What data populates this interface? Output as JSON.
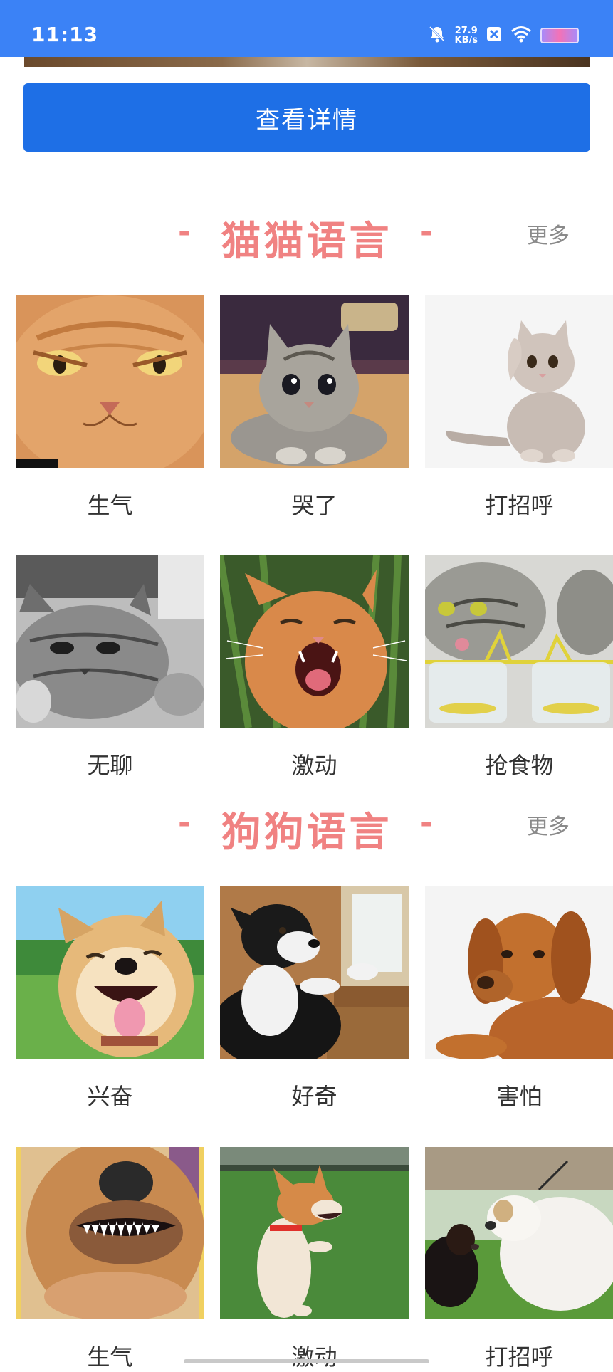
{
  "status_bar": {
    "time": "11:13",
    "net_speed_value": "27.9",
    "net_speed_unit": "KB/s"
  },
  "detail_button_label": "查看详情",
  "cat_section": {
    "title": "猫猫语言",
    "dash_left": "-",
    "dash_right": "-",
    "more_label": "更多",
    "items": [
      {
        "label": "生气",
        "icon": "angry-cat-photo"
      },
      {
        "label": "哭了",
        "icon": "sad-cat-photo"
      },
      {
        "label": "打招呼",
        "icon": "waving-kitten-photo"
      },
      {
        "label": "无聊",
        "icon": "bored-cat-photo"
      },
      {
        "label": "激动",
        "icon": "excited-cat-photo"
      },
      {
        "label": "抢食物",
        "icon": "grabbing-food-cat-photo"
      }
    ]
  },
  "dog_section": {
    "title": "狗狗语言",
    "dash_left": "-",
    "dash_right": "-",
    "more_label": "更多",
    "items": [
      {
        "label": "兴奋",
        "icon": "happy-shiba-photo"
      },
      {
        "label": "好奇",
        "icon": "curious-puppy-photo"
      },
      {
        "label": "害怕",
        "icon": "scared-retriever-photo"
      },
      {
        "label": "生气",
        "icon": "angry-dog-photo"
      },
      {
        "label": "激动",
        "icon": "excited-corgi-photo"
      },
      {
        "label": "打招呼",
        "icon": "greeting-dogs-photo"
      }
    ]
  },
  "colors": {
    "status_bar": "#3b82f6",
    "button": "#1e6fe6",
    "section_title": "#f08282",
    "more_link": "#8a8a8a",
    "label_text": "#333333"
  }
}
